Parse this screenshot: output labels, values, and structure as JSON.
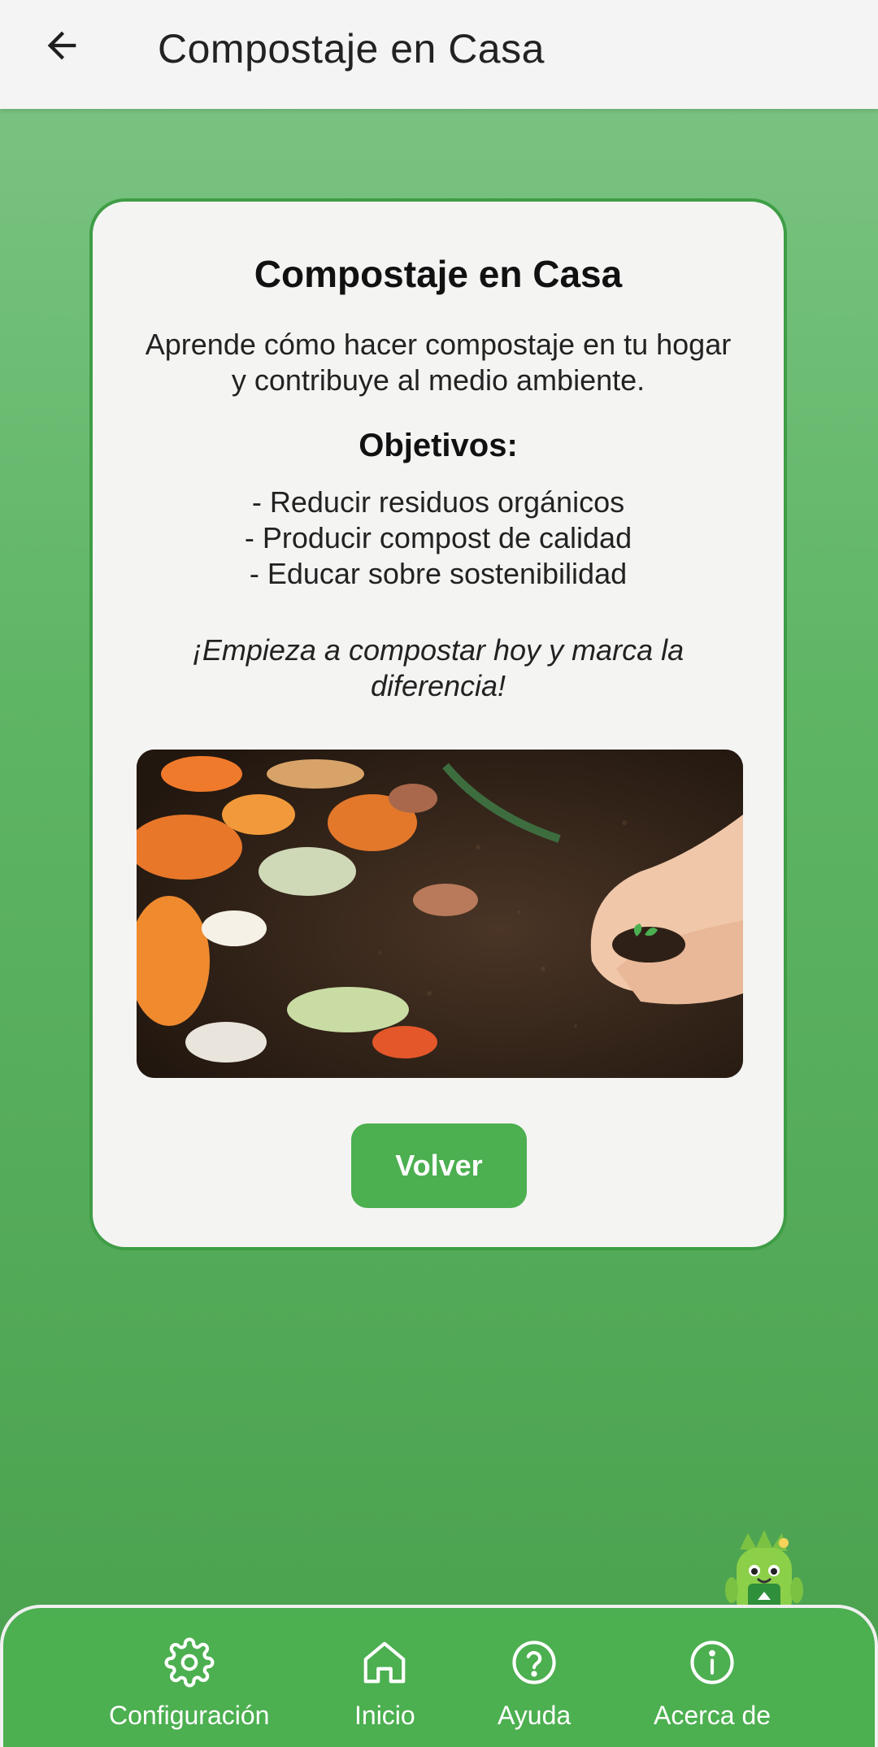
{
  "header": {
    "title": "Compostaje en Casa",
    "back_icon": "arrow-left-icon"
  },
  "card": {
    "title": "Compostaje en Casa",
    "intro": "Aprende cómo hacer compostaje en tu hogar y contribuye al medio ambiente.",
    "objectives_title": "Objetivos:",
    "objectives": [
      "- Reducir residuos orgánicos",
      "- Producir compost de calidad",
      "- Educar sobre sostenibilidad"
    ],
    "cta": "¡Empieza a compostar hoy y marca la diferencia!",
    "image_icon": "compost-photo",
    "button_label": "Volver"
  },
  "bottom_nav": {
    "items": [
      {
        "label": "Configuración",
        "icon": "gear-icon"
      },
      {
        "label": "Inicio",
        "icon": "home-icon"
      },
      {
        "label": "Ayuda",
        "icon": "help-circle-icon"
      },
      {
        "label": "Acerca de",
        "icon": "info-circle-icon"
      }
    ]
  },
  "colors": {
    "accent": "#4caf50",
    "card_border": "#3f9d46",
    "background_top": "#7ec586",
    "background_bottom": "#49a04d"
  }
}
